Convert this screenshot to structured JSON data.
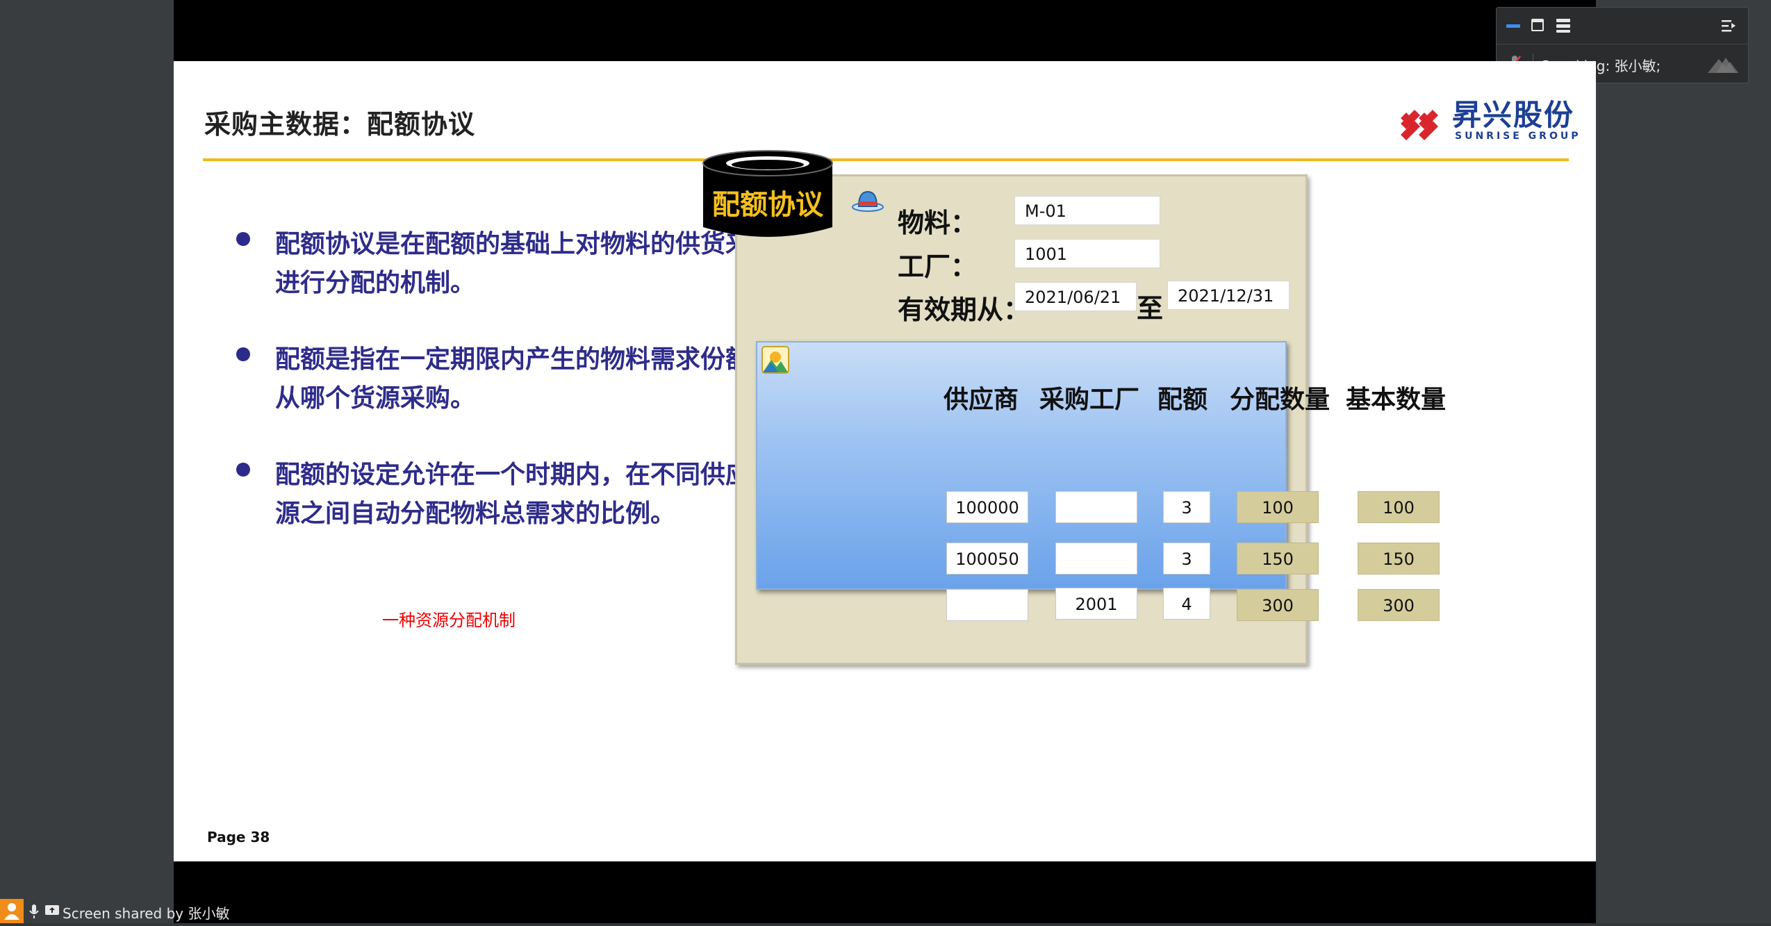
{
  "toolbar": {
    "speaking_label": "Speaking: 张小敏;"
  },
  "status_bar": {
    "share_text": "Screen shared by 张小敏"
  },
  "slide": {
    "title": "采购主数据：配额协议",
    "logo": {
      "cn": "昇兴股份",
      "en": "SUNRISE GROUP"
    },
    "bullets": [
      "配额协议是在配额的基础上对物料的供货来源进行分配的机制。",
      "配额是指在一定期限内产生的物料需求份额将从哪个货源采购。",
      "配额的设定允许在一个时期内，在不同供应来源之间自动分配物料总需求的比例。"
    ],
    "note": "一种资源分配机制",
    "page": "Page 38",
    "colors": {
      "bullet_text": "#2e2c8a",
      "title_rule": "#f2b71b",
      "note": "#e00000",
      "logo": "#1c3f95"
    }
  },
  "quota": {
    "drum_label": "配额协议",
    "material_label": "物料：",
    "material_value": "M-01",
    "plant_label": "工厂：",
    "plant_value": "1001",
    "valid_label": "有效期从：",
    "valid_from": "2021/06/21",
    "to_label": "至",
    "valid_to": "2021/12/31",
    "table": {
      "headers": [
        "供应商",
        "采购工厂",
        "配额",
        "分配数量",
        "基本数量"
      ],
      "rows": [
        {
          "vendor": "100000",
          "plant": "",
          "quota": "3",
          "alloc": "100",
          "base": "100"
        },
        {
          "vendor": "100050",
          "plant": "",
          "quota": "3",
          "alloc": "150",
          "base": "150"
        },
        {
          "vendor": "",
          "plant": "2001",
          "quota": "4",
          "alloc": "300",
          "base": "300"
        }
      ]
    }
  }
}
